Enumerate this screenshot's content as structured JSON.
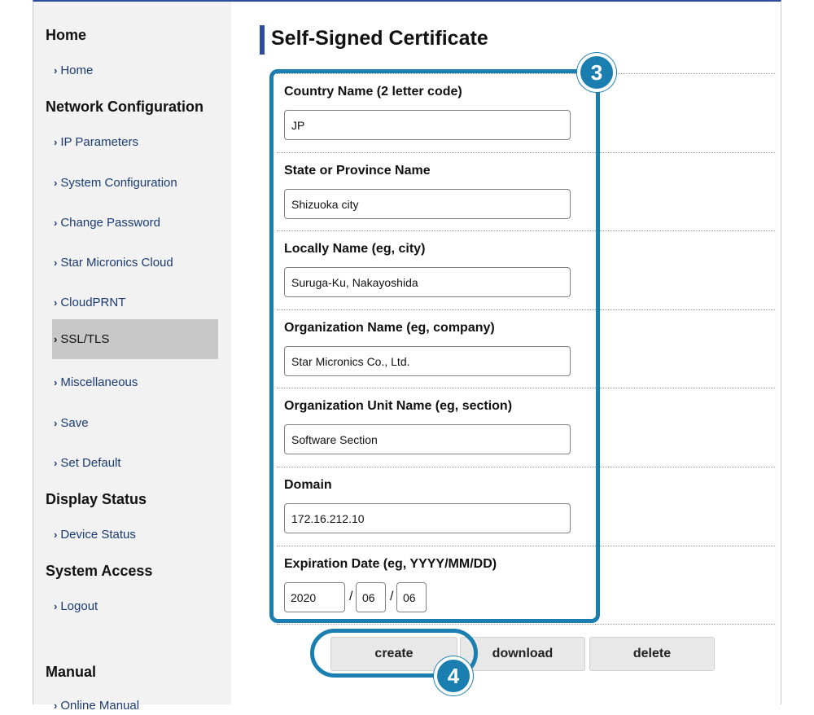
{
  "sidebar": {
    "sections": {
      "home": "Home",
      "network": "Network Configuration",
      "display": "Display Status",
      "system": "System Access",
      "manual": "Manual"
    },
    "items": {
      "home": "Home",
      "ip": "IP Parameters",
      "sysconfig": "System Configuration",
      "password": "Change Password",
      "cloud": "Star Micronics Cloud",
      "cloudprnt": "CloudPRNT",
      "ssl": "SSL/TLS",
      "misc": "Miscellaneous",
      "save": "Save",
      "default": "Set Default",
      "device": "Device Status",
      "logout": "Logout",
      "online_manual": "Online Manual"
    },
    "chevron": "›",
    "active_item": "SSL/TLS"
  },
  "page": {
    "title": "Self-Signed Certificate"
  },
  "form": {
    "country": {
      "label": "Country Name (2 letter code)",
      "value": "JP"
    },
    "state": {
      "label": "State or Province Name",
      "value": "Shizuoka city"
    },
    "locality": {
      "label": "Locally Name (eg, city)",
      "value": "Suruga-Ku, Nakayoshida"
    },
    "org": {
      "label": "Organization Name (eg, company)",
      "value": "Star Micronics Co., Ltd."
    },
    "unit": {
      "label": "Organization Unit Name (eg, section)",
      "value": "Software Section"
    },
    "domain": {
      "label": "Domain",
      "value": "172.16.212.10"
    },
    "expiration": {
      "label": "Expiration Date (eg, YYYY/MM/DD)",
      "year": "2020",
      "month": "06",
      "day": "06",
      "separator": "/"
    }
  },
  "buttons": {
    "create": "create",
    "download": "download",
    "delete": "delete"
  },
  "callouts": {
    "step3": "3",
    "step4": "4",
    "color": "#1a7fb0"
  },
  "colors": {
    "nav_link": "#1a3b73",
    "title_bar": "#2d4d9a",
    "active_bg": "#c7c7c7"
  }
}
